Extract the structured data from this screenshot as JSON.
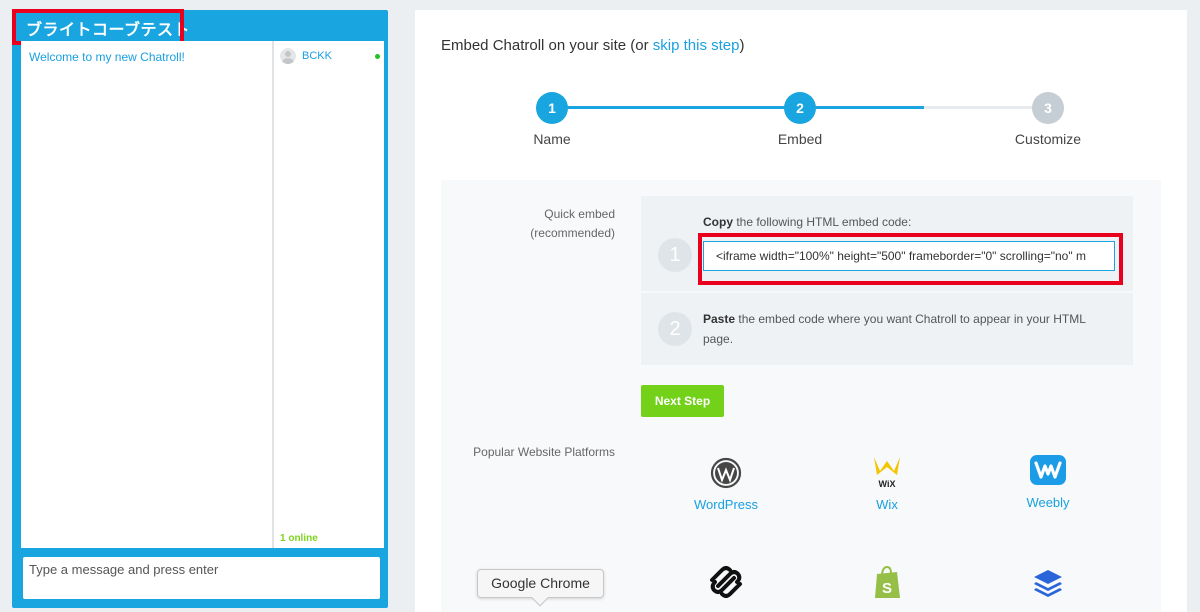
{
  "chat": {
    "title": "ブライトコーブテスト",
    "messages": [
      {
        "text": "Welcome to my new Chatroll!"
      }
    ],
    "users": [
      {
        "name": "BCKK",
        "status": "online"
      }
    ],
    "online_count": "1 online",
    "input_placeholder": "Type a message and press enter",
    "colors": {
      "frame": "#19a6e0",
      "highlight": "#e8001c",
      "online": "#22c322"
    }
  },
  "embed": {
    "heading_prefix": "Embed Chatroll on your site (or ",
    "heading_link": "skip this step",
    "heading_suffix": ")",
    "steps": [
      {
        "number": "1",
        "label": "Name",
        "state": "done"
      },
      {
        "number": "2",
        "label": "Embed",
        "state": "current"
      },
      {
        "number": "3",
        "label": "Customize",
        "state": "pending"
      }
    ],
    "quick_embed_label": "Quick embed",
    "quick_embed_sub": "(recommended)",
    "copy_step": {
      "number": "1",
      "bold": "Copy",
      "text": " the following HTML embed code:",
      "code": "<iframe width=\"100%\" height=\"500\" frameborder=\"0\" scrolling=\"no\" m"
    },
    "paste_step": {
      "number": "2",
      "bold": "Paste",
      "text": " the embed code where you want Chatroll to appear in your HTML page."
    },
    "next_button": "Next Step",
    "platforms_label": "Popular Website Platforms",
    "platforms": [
      {
        "name": "WordPress",
        "icon": "wordpress-icon"
      },
      {
        "name": "Wix",
        "icon": "wix-icon"
      },
      {
        "name": "Weebly",
        "icon": "weebly-icon"
      },
      {
        "name": "",
        "icon": "squarespace-icon"
      },
      {
        "name": "",
        "icon": "shopify-icon"
      },
      {
        "name": "",
        "icon": "layers-icon"
      }
    ],
    "accent": "#19a6e0",
    "button_color": "#74d11a"
  },
  "tooltip": {
    "text": "Google Chrome"
  }
}
